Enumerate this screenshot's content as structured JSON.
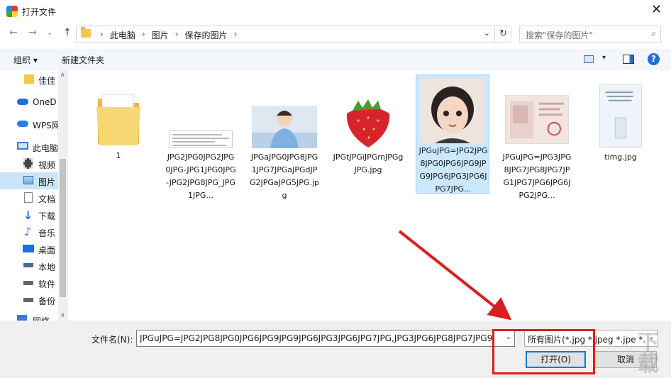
{
  "window": {
    "title": "打开文件",
    "close": "✕"
  },
  "nav": {
    "back": "←",
    "forward": "→",
    "dropdown": "⌄",
    "up": "↑"
  },
  "address": {
    "sep": "›",
    "crumbs": [
      "此电脑",
      "图片",
      "保存的图片"
    ],
    "drop": "⌄",
    "refresh": "↻"
  },
  "search": {
    "placeholder": "搜索\"保存的图片\"",
    "icon": "⌕"
  },
  "toolbar": {
    "organize": "组织 ▾",
    "new_folder": "新建文件夹",
    "view_dropdown": "▾",
    "help": "?"
  },
  "sidebar": {
    "items": [
      {
        "label": "佳佳",
        "icon": "folder-icon"
      },
      {
        "label": "OneD",
        "icon": "cloud-icon"
      },
      {
        "label": "WPS网",
        "icon": "cloud-icon"
      },
      {
        "label": "此电脑",
        "icon": "pc-icon"
      },
      {
        "label": "视频",
        "icon": "video-icon"
      },
      {
        "label": "图片",
        "icon": "picture-icon"
      },
      {
        "label": "文档",
        "icon": "document-icon"
      },
      {
        "label": "下载",
        "icon": "download-icon"
      },
      {
        "label": "音乐",
        "icon": "music-icon"
      },
      {
        "label": "桌面",
        "icon": "desktop-icon"
      },
      {
        "label": "本地",
        "icon": "drive-icon"
      },
      {
        "label": "软件",
        "icon": "drive-icon"
      },
      {
        "label": "备份",
        "icon": "drive-icon"
      },
      {
        "label": "网络",
        "icon": "network-icon"
      }
    ],
    "scroll_up": "∧",
    "scroll_down": "∨"
  },
  "files": [
    {
      "name": "1",
      "kind": "folder"
    },
    {
      "name": "JPG2JPG0JPG2JPG0JPG-JPG1JPG0JPG-JPG2JPG8JPG_JPG1JPG...",
      "kind": "document"
    },
    {
      "name": "JPGaJPG0JPG8JPG1JPG7JPGaJPGdJPG2JPGaJPG5JPG.jpg",
      "kind": "photo"
    },
    {
      "name": "JPGtJPGiJPGmJPGgJPG.jpg",
      "kind": "strawberry"
    },
    {
      "name": "JPGuJPG=JPG2JPG8JPG0JPG6JPG9JPG9JPG6JPG3JPG6JPG7JPG...",
      "kind": "portrait",
      "selected": true
    },
    {
      "name": "JPGuJPG=JPG3JPG8JPG7JPG8JPG7JPG1JPG7JPG6JPG6JPG2JPG...",
      "kind": "passport"
    },
    {
      "name": "timg.jpg",
      "kind": "poster"
    }
  ],
  "bottom": {
    "filename_label": "文件名(N):",
    "filename_value": "JPGuJPG=JPG2JPG8JPG0JPG6JPG9JPG9JPG6JPG3JPG6JPG7JPG,JPG3JPG6JPG8JPG7JPG9JP",
    "filename_drop": "⌄",
    "filetype_value": "所有图片(*.jpg *.jpeg *.jpe *.b",
    "filetype_drop": "⌄",
    "open_button": "打开(O)",
    "cancel_button": "取消"
  },
  "watermark": "下载"
}
